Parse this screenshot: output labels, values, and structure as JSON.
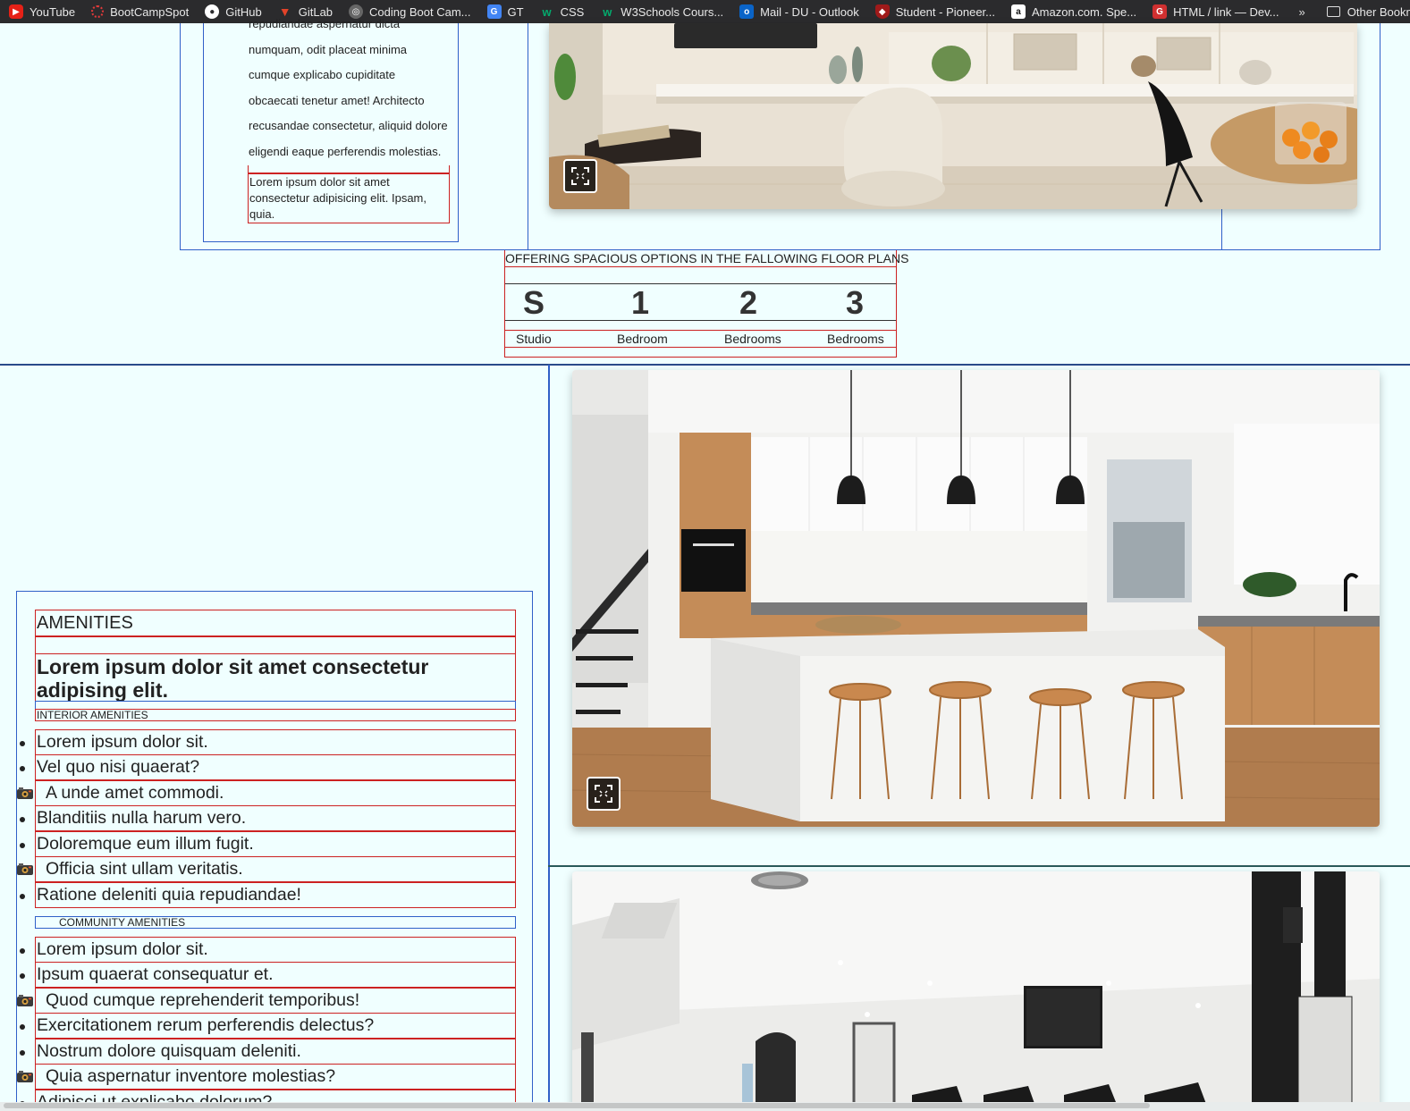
{
  "bookmarks": [
    {
      "label": "YouTube",
      "icon": "youtube-icon",
      "color": "#e62117"
    },
    {
      "label": "BootCampSpot",
      "icon": "bootcampspot-icon",
      "color": "#e23a3a"
    },
    {
      "label": "GitHub",
      "icon": "github-icon",
      "color": "#2b2b2d"
    },
    {
      "label": "GitLab",
      "icon": "gitlab-icon",
      "color": "#e24329"
    },
    {
      "label": "Coding Boot Cam...",
      "icon": "globe-icon",
      "color": "#666666"
    },
    {
      "label": "GT",
      "icon": "google-translate-icon",
      "color": "#4285f4"
    },
    {
      "label": "CSS",
      "icon": "w3schools-icon",
      "color": "#04aa6d"
    },
    {
      "label": "W3Schools Cours...",
      "icon": "w3schools-icon",
      "color": "#04aa6d"
    },
    {
      "label": "Mail - DU - Outlook",
      "icon": "outlook-icon",
      "color": "#0a64c8"
    },
    {
      "label": "Student - Pioneer...",
      "icon": "shield-icon",
      "color": "#a01a1a"
    },
    {
      "label": "Amazon.com. Spe...",
      "icon": "amazon-icon",
      "color": "#ffffff"
    },
    {
      "label": "HTML / link — Dev...",
      "icon": "mdn-icon",
      "color": "#d03030"
    }
  ],
  "bookmarks_more": "»",
  "bookmarks_other": "Other Bookmarks",
  "intro": {
    "lines": [
      "repudiandae aspernatur dicta",
      "numquam, odit placeat minima",
      "cumque explicabo cupiditate",
      "obcaecati tenetur amet! Architecto",
      "recusandae consectetur, aliquid dolore",
      "eligendi eaque perferendis molestias."
    ],
    "small_text": "Lorem ipsum dolor sit amet consectetur adipisicing elit. Ipsam, quia."
  },
  "floor_plans": {
    "title": "OFFERING SPACIOUS OPTIONS IN THE FALLOWING FLOOR PLANS",
    "items": [
      {
        "number": "S",
        "label": "Studio"
      },
      {
        "number": "1",
        "label": "Bedroom"
      },
      {
        "number": "2",
        "label": "Bedrooms"
      },
      {
        "number": "3",
        "label": "Bedrooms"
      }
    ]
  },
  "amenities": {
    "heading": "AMENITIES",
    "tagline": "Lorem ipsum dolor sit amet consectetur adipising elit.",
    "interior_title": "INTERIOR AMENITIES",
    "interior": [
      {
        "text": "Lorem ipsum dolor sit.",
        "marker": "bullet"
      },
      {
        "text": "Vel quo nisi quaerat?",
        "marker": "bullet"
      },
      {
        "text": "A unde amet commodi.",
        "marker": "camera-icon"
      },
      {
        "text": "Blanditiis nulla harum vero.",
        "marker": "bullet"
      },
      {
        "text": "Doloremque eum illum fugit.",
        "marker": "bullet"
      },
      {
        "text": "Officia sint ullam veritatis.",
        "marker": "camera-icon"
      },
      {
        "text": "Ratione deleniti quia repudiandae!",
        "marker": "bullet"
      }
    ],
    "community_title": "COMMUNITY AMENITIES",
    "community": [
      {
        "text": "Lorem ipsum dolor sit.",
        "marker": "bullet"
      },
      {
        "text": "Ipsum quaerat consequatur et.",
        "marker": "bullet"
      },
      {
        "text": "Quod cumque reprehenderit temporibus!",
        "marker": "camera-icon"
      },
      {
        "text": "Exercitationem rerum perferendis delectus?",
        "marker": "bullet"
      },
      {
        "text": "Nostrum dolore quisquam deleniti.",
        "marker": "bullet"
      },
      {
        "text": "Quia aspernatur inventore molestias?",
        "marker": "camera-icon"
      },
      {
        "text": "Adipisci ut explicabo dolorum?",
        "marker": "bullet"
      }
    ]
  },
  "photos": [
    {
      "name": "living-room-photo",
      "icon": "expand-icon"
    },
    {
      "name": "kitchen-photo",
      "icon": "expand-icon"
    },
    {
      "name": "gym-photo",
      "icon": "expand-icon"
    }
  ],
  "colors": {
    "page_bg": "#f0ffff",
    "outline_red": "#cc2222",
    "outline_blue": "#3060c8",
    "bookmark_bar": "#2b2b2d"
  }
}
